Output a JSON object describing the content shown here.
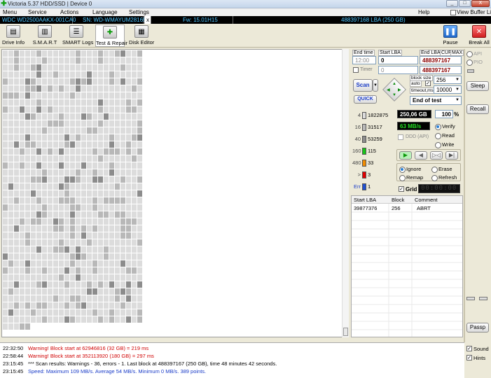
{
  "window": {
    "title": "Victoria 5.37 HDD/SSD | Device 0",
    "min": "_",
    "max": "□",
    "close": "X"
  },
  "menu": {
    "items": [
      "Menu",
      "Service",
      "Actions",
      "Language",
      "Settings"
    ],
    "help": "Help",
    "view_buffer": "View Buffer Live"
  },
  "drive": {
    "model": "WDC WD2500AAKX-001CA0",
    "serial": "SN: WD-WMAYUM281692",
    "close": "x",
    "firmware": "Fw: 15.01H15",
    "capacity": "488397168 LBA (250 GB)"
  },
  "toolbar": {
    "drive_info": "Drive Info",
    "smart": "S.M.A.R.T",
    "smart_logs": "SMART Logs",
    "test_repair": "Test & Repair",
    "disk_editor": "Disk Editor",
    "pause": "Pause",
    "break_all": "Break All"
  },
  "scan": {
    "end_time_label": "End time",
    "start_lba_label": "Start LBA",
    "end_lba_label": "End LBA",
    "cur": "CUR",
    "max": "MAX",
    "end_time_value": "12:00",
    "start_lba_value": "0",
    "end_lba_value": "488397167",
    "timer_label": "Timer",
    "timer_value": "0",
    "end_lba_value2": "488397167",
    "scan_btn": "Scan",
    "quick_btn": "QUICK",
    "block_size_label": "block size",
    "auto_label": "auto",
    "block_size_value": "256",
    "timeout_label": "timeout,ms",
    "timeout_value": "10000",
    "end_of_test": "End of test",
    "api": "API",
    "pio": "PIO",
    "sleep": "Sleep",
    "recall": "Recall",
    "passp": "Passp"
  },
  "stats": {
    "rows": [
      {
        "label": "4",
        "value": "1822875",
        "color": "#dcdcdc"
      },
      {
        "label": "16",
        "value": "31517",
        "color": "#b8b8b8"
      },
      {
        "label": "40",
        "value": "53259",
        "color": "#8c8c8c"
      },
      {
        "label": "160",
        "value": "115",
        "color": "#18c418"
      },
      {
        "label": "480",
        "value": "33",
        "color": "#f08c00"
      },
      {
        "label": ">",
        "value": "3",
        "color": "#e00000"
      },
      {
        "label": "Err",
        "value": "1",
        "color": "#2050d0"
      }
    ],
    "size_read": "250,06 GB",
    "percent": "100",
    "percent_unit": "%",
    "speed": "63 MB/s",
    "ddd": "DDD (API)",
    "verify": "Verify",
    "read": "Read",
    "write": "Write",
    "ignore": "Ignore",
    "erase": "Erase",
    "remap": "Remap",
    "refresh": "Refresh",
    "grid": "Grid",
    "timer_display": "00:00:00"
  },
  "errors_table": {
    "headers": [
      "Start LBA",
      "Block",
      "Comment"
    ],
    "rows": [
      [
        "39877376",
        "256",
        "ABRT"
      ]
    ]
  },
  "log": [
    {
      "time": "22:32:50",
      "text": "Warning! Block start at 62946816 (32 GB)  = 219 ms",
      "color": "#d00000"
    },
    {
      "time": "22:58:44",
      "text": "Warning! Block start at 352113920 (180 GB)  = 297 ms",
      "color": "#d00000"
    },
    {
      "time": "23:15:45",
      "text": "*** Scan results: Warnings - 36, errors - 1. Last block at 488397167 (250 GB), time 48 minutes 42 seconds.",
      "color": "#000000"
    },
    {
      "time": "23:15:45",
      "text": "Speed: Maximum 109 MB/s. Average 54 MB/s. Minimum 0 MB/s. 389 points.",
      "color": "#1a3cc8"
    }
  ],
  "sound": {
    "sound": "Sound",
    "hints": "Hints"
  }
}
